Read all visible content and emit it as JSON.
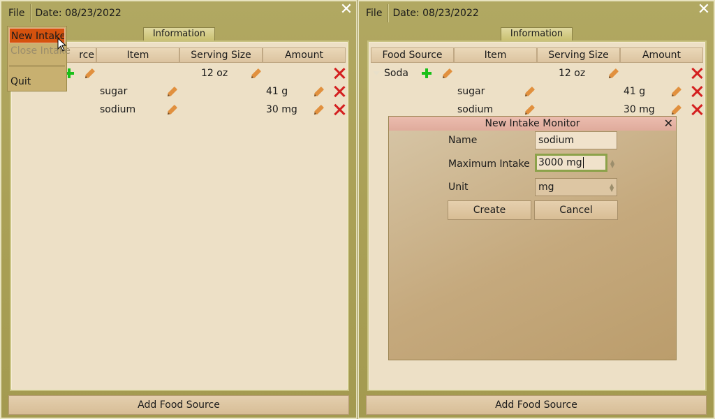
{
  "menubar": {
    "file_label": "File",
    "date_label": "Date: 08/23/2022"
  },
  "tab_label": "Information",
  "columns": [
    "Food Source",
    "Item",
    "Serving Size",
    "Amount"
  ],
  "left_columns": [
    "rce",
    "Item",
    "Serving Size",
    "Amount"
  ],
  "rows": {
    "food": {
      "source": "Soda",
      "serving": "12 oz"
    },
    "items": [
      {
        "name": "sugar",
        "amount": "41 g"
      },
      {
        "name": "sodium",
        "amount": "30 mg"
      }
    ]
  },
  "add_food_label": "Add Food Source",
  "file_menu": {
    "new_intake": "New Intake",
    "close_intake": "Close Intake",
    "quit": "Quit"
  },
  "dialog": {
    "title": "New Intake Monitor",
    "name_label": "Name",
    "name_value": "sodium",
    "max_label": "Maximum Intake",
    "max_value": "3000 mg",
    "unit_label": "Unit",
    "unit_value": "mg",
    "create_label": "Create",
    "cancel_label": "Cancel"
  },
  "colors": {
    "accent_menu": "#d5520e",
    "delete": "#d42020",
    "add": "#19c019",
    "focus": "#8ca24a"
  },
  "icons": {
    "close": "close-icon",
    "edit": "pencil-icon",
    "delete": "x-icon",
    "add": "plus-icon"
  }
}
